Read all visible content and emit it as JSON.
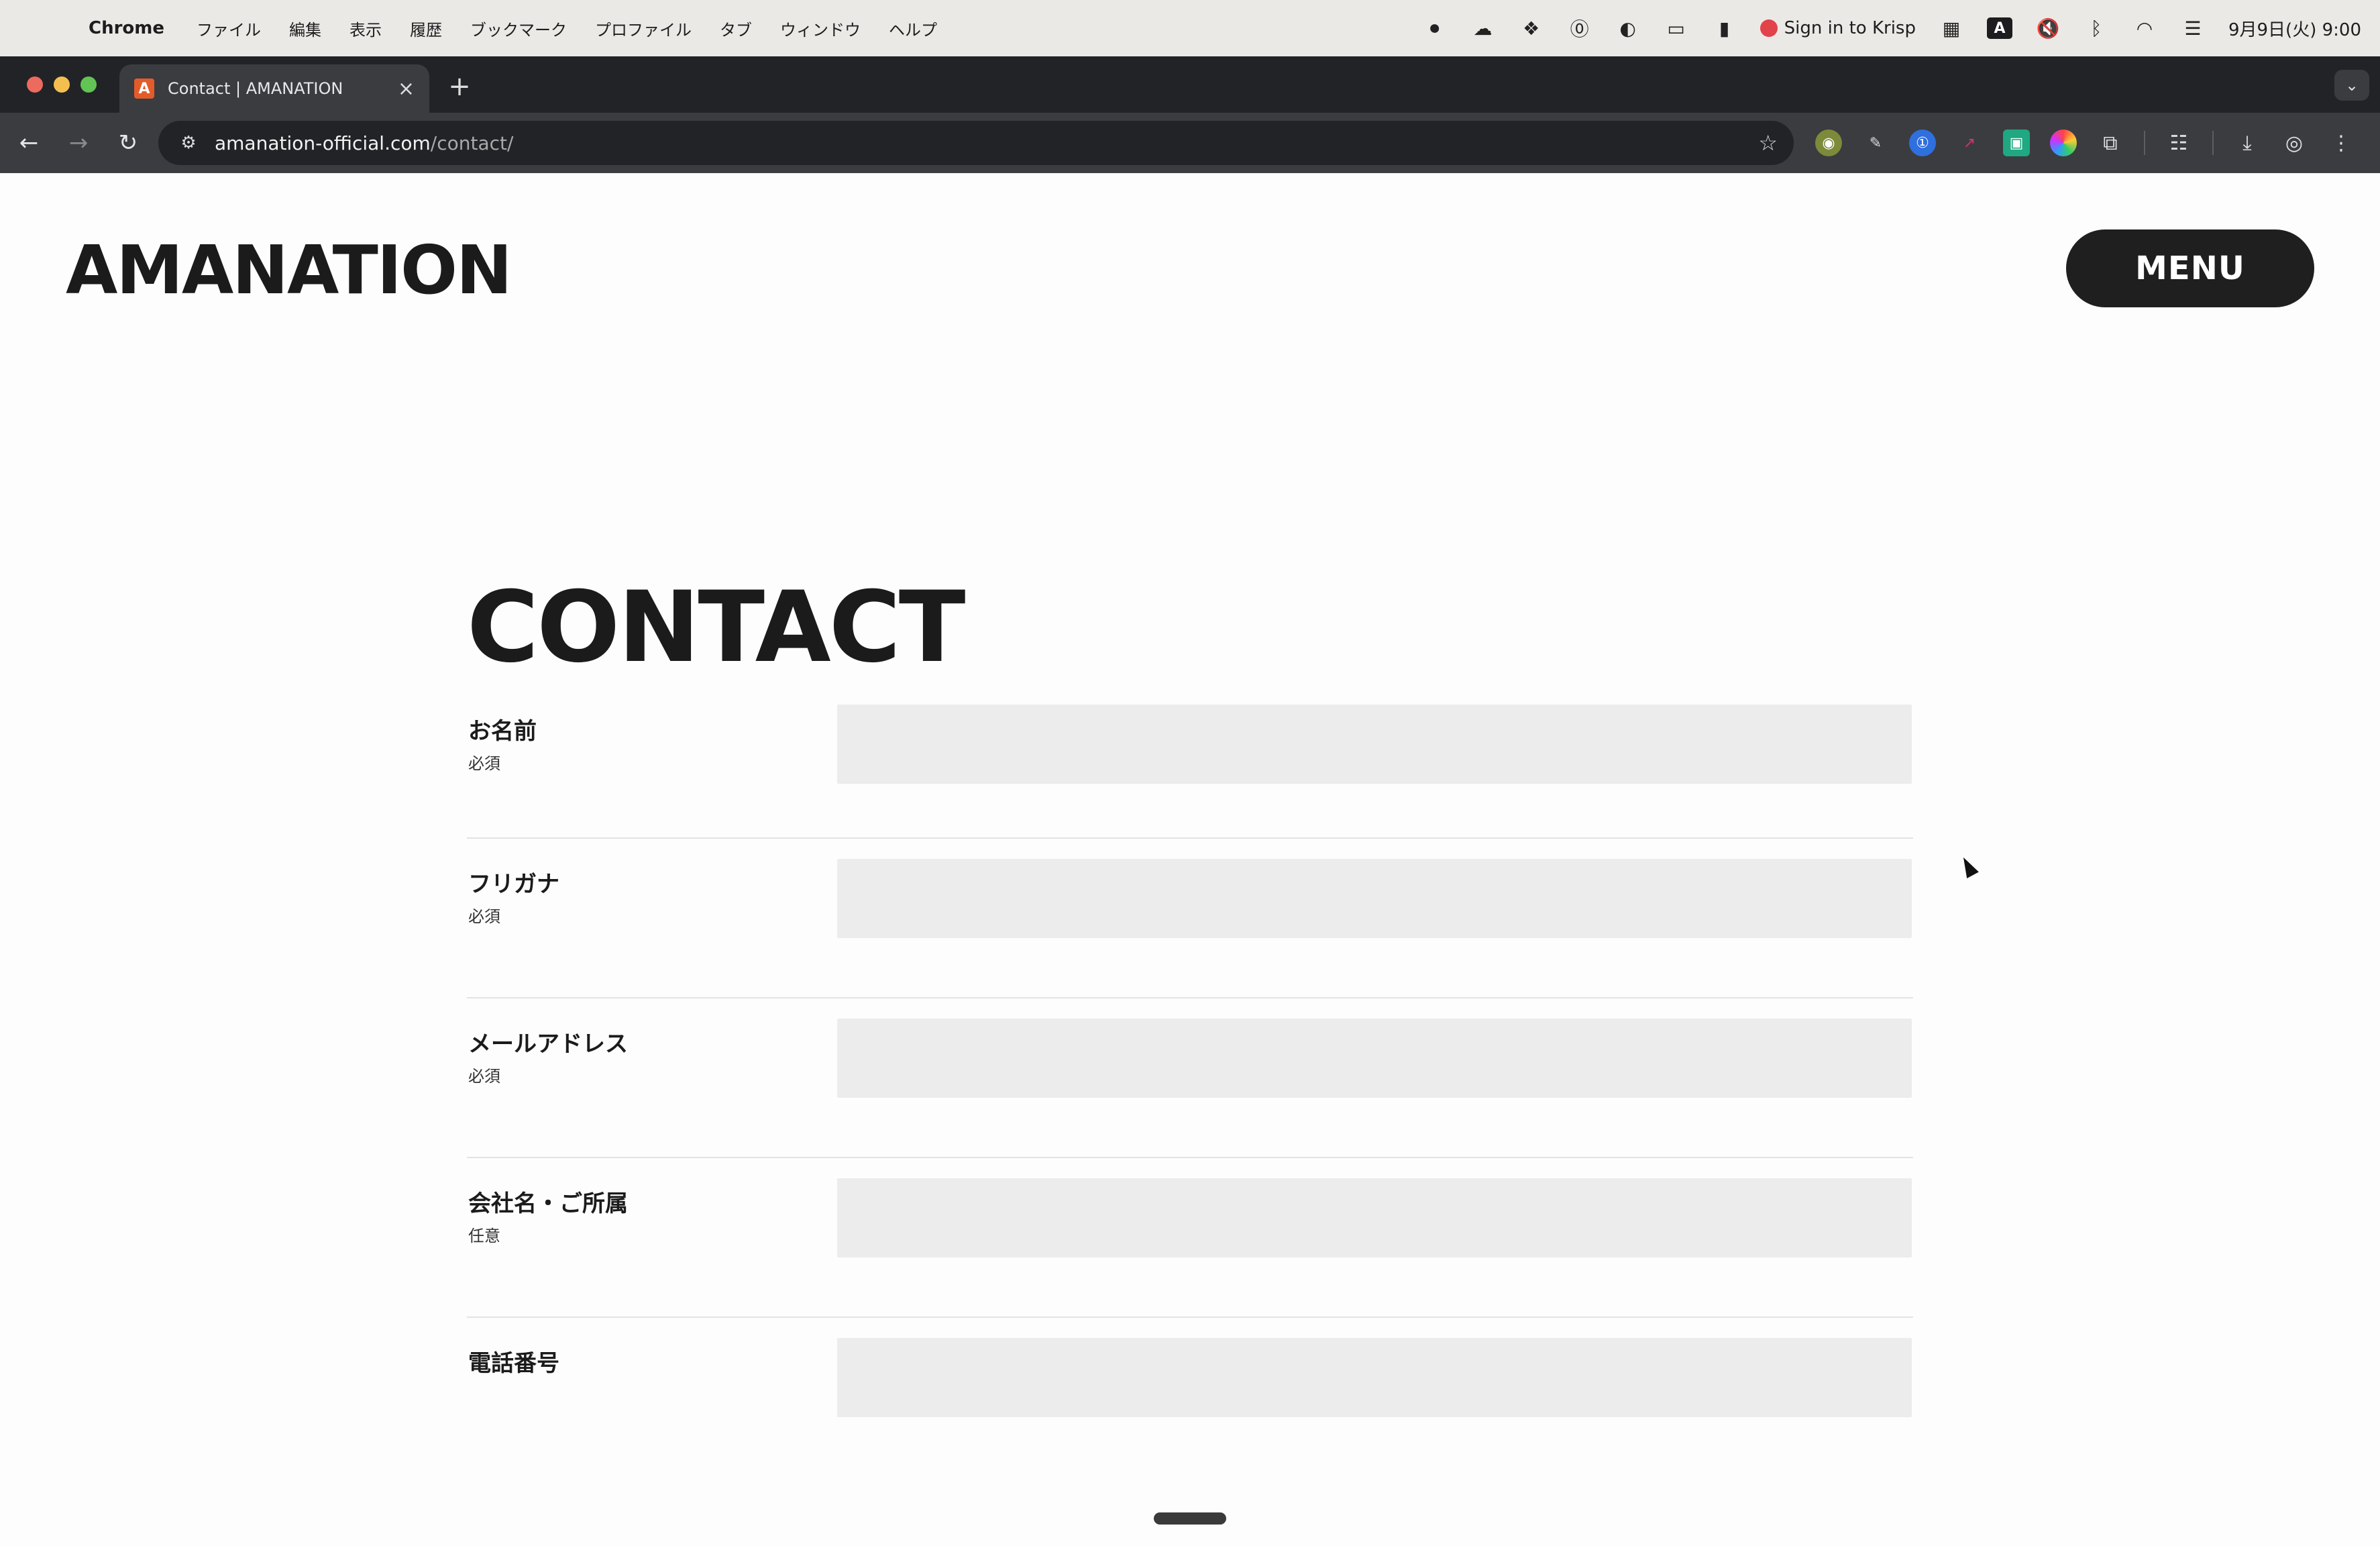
{
  "menubar": {
    "app_name": "Chrome",
    "items": [
      "ファイル",
      "編集",
      "表示",
      "履歴",
      "ブックマーク",
      "プロファイル",
      "タブ",
      "ウィンドウ",
      "ヘルプ"
    ],
    "krisp": "Sign in to Krisp",
    "input_badge": "A",
    "clock": "9月9日(火) 9:00"
  },
  "browser": {
    "tab_title": "Contact | AMANATION",
    "favicon_letter": "A",
    "url_host": "amanation-official.com",
    "url_path": "/contact/"
  },
  "page": {
    "logo": "AMANATION",
    "menu_label": "MENU",
    "heading": "CONTACT"
  },
  "form": {
    "fields": [
      {
        "label": "お名前",
        "requirement": "必須",
        "value": ""
      },
      {
        "label": "フリガナ",
        "requirement": "必須",
        "value": ""
      },
      {
        "label": "メールアドレス",
        "requirement": "必須",
        "value": ""
      },
      {
        "label": "会社名・ご所属",
        "requirement": "任意",
        "value": ""
      },
      {
        "label": "電話番号",
        "requirement": "",
        "value": ""
      }
    ]
  },
  "colors": {
    "accent_dark": "#1f1f1f",
    "input_bg": "#ececec",
    "favicon": "#e35b2a"
  },
  "icons": [
    "apple-icon",
    "record-icon",
    "cloud-icon",
    "dropbox-icon",
    "onepassword-icon",
    "moon-icon",
    "display-icon",
    "battery-icon",
    "krisp-icon",
    "memory-icon",
    "mute-icon",
    "bluetooth-icon",
    "wifi-icon",
    "control-center-icon"
  ]
}
